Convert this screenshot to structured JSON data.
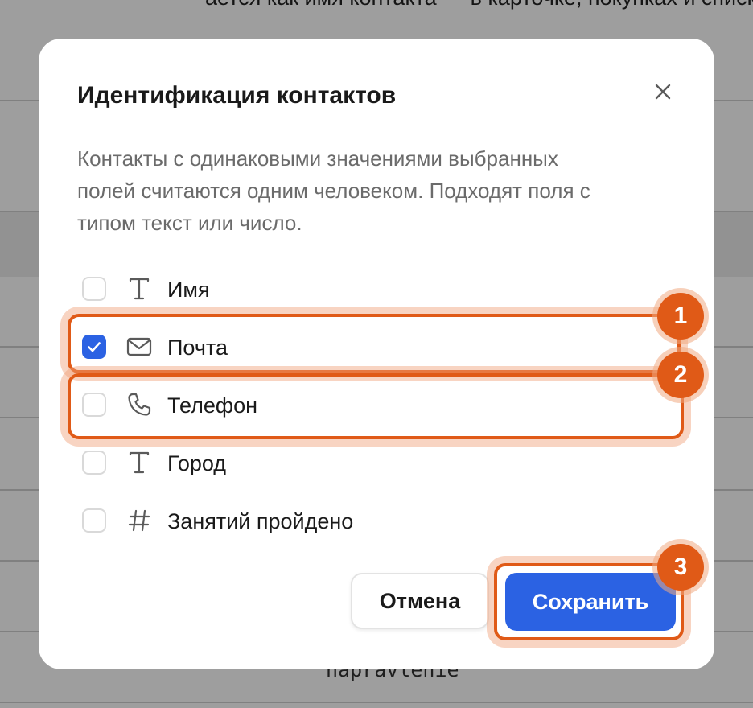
{
  "background": {
    "top_text": "ается как имя контакта — в карточке, покупках и списках.",
    "bottom_text": "napravlenie"
  },
  "dialog": {
    "title": "Идентификация контактов",
    "close_icon": "close-icon",
    "description_lines": [
      "Контакты с одинаковыми значениями выбранных",
      "полей считаются одним человеком. Подходят поля с",
      "типом текст или число."
    ],
    "fields": [
      {
        "label": "Имя",
        "icon": "text-type-icon",
        "checked": false
      },
      {
        "label": "Почта",
        "icon": "mail-icon",
        "checked": true
      },
      {
        "label": "Телефон",
        "icon": "phone-icon",
        "checked": false
      },
      {
        "label": "Город",
        "icon": "text-type-icon",
        "checked": false
      },
      {
        "label": "Занятий пройдено",
        "icon": "number-type-icon",
        "checked": false
      }
    ],
    "cancel_label": "Отмена",
    "save_label": "Сохранить"
  },
  "annotations": {
    "badges": [
      "1",
      "2",
      "3"
    ],
    "accent_color": "#e05a17"
  },
  "colors": {
    "primary": "#2b62e3",
    "text": "#1a1a1a",
    "muted": "#6b6b6b"
  }
}
